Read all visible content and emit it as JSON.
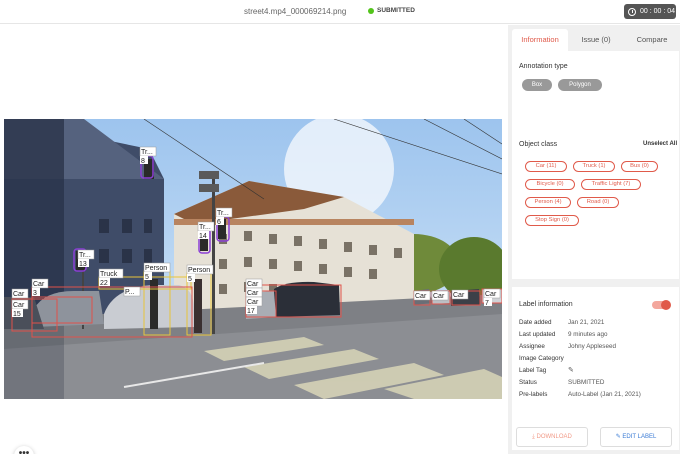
{
  "header": {
    "filename": "street4.mp4_000069214.png",
    "status": "SUBMITTED",
    "timer": "00 : 00 : 04"
  },
  "tabs": [
    {
      "label": "Information"
    },
    {
      "label": "Issue (0)"
    },
    {
      "label": "Compare"
    }
  ],
  "annotation_type": {
    "title": "Annotation type",
    "options": [
      "Box",
      "Polygon"
    ]
  },
  "object_class": {
    "title": "Object class",
    "unselect_label": "Unselect All",
    "classes": [
      "Car (11)",
      "Truck (1)",
      "Bus (0)",
      "Bicycle (0)",
      "Traffic Light (7)",
      "Person (4)",
      "Road (0)",
      "Stop Sign (0)"
    ]
  },
  "label_info": {
    "title": "Label information",
    "rows": [
      {
        "label": "Date added",
        "value": "Jan 21, 2021"
      },
      {
        "label": "Last updated",
        "value": "9 minutes ago"
      },
      {
        "label": "Assignee",
        "value": "Johny Appleseed"
      },
      {
        "label": "Image Category",
        "value": ""
      },
      {
        "label": "Label Tag",
        "value": ""
      },
      {
        "label": "Status",
        "value": "SUBMITTED"
      },
      {
        "label": "Pre-labels",
        "value": "Auto-Label (Jan 21, 2021)"
      }
    ]
  },
  "buttons": {
    "download": "DOWNLOAD",
    "edit": "EDIT LABEL"
  },
  "more_label": "•••",
  "image_labels": {
    "tl1": "Tr...",
    "tl1n": "8",
    "tl2": "Tr...",
    "tl2n": "6",
    "tl3": "Tr...",
    "tl3n": "14",
    "tl4": "Tr...",
    "tl4n": "13",
    "truck": "Truck",
    "truckn": "22",
    "person1": "Person",
    "person1n": "5",
    "person2": "Person",
    "person2n": "5",
    "car1": "Car",
    "car1n": "3",
    "car2": "Car",
    "car3": "Car",
    "car3n": "15",
    "car4": "Car",
    "car5": "Car",
    "car6": "Car",
    "car6n": "17",
    "car7": "Car",
    "car8": "Car",
    "car9": "Car",
    "car10": "Car",
    "car10n": "7",
    "p": "P..."
  }
}
